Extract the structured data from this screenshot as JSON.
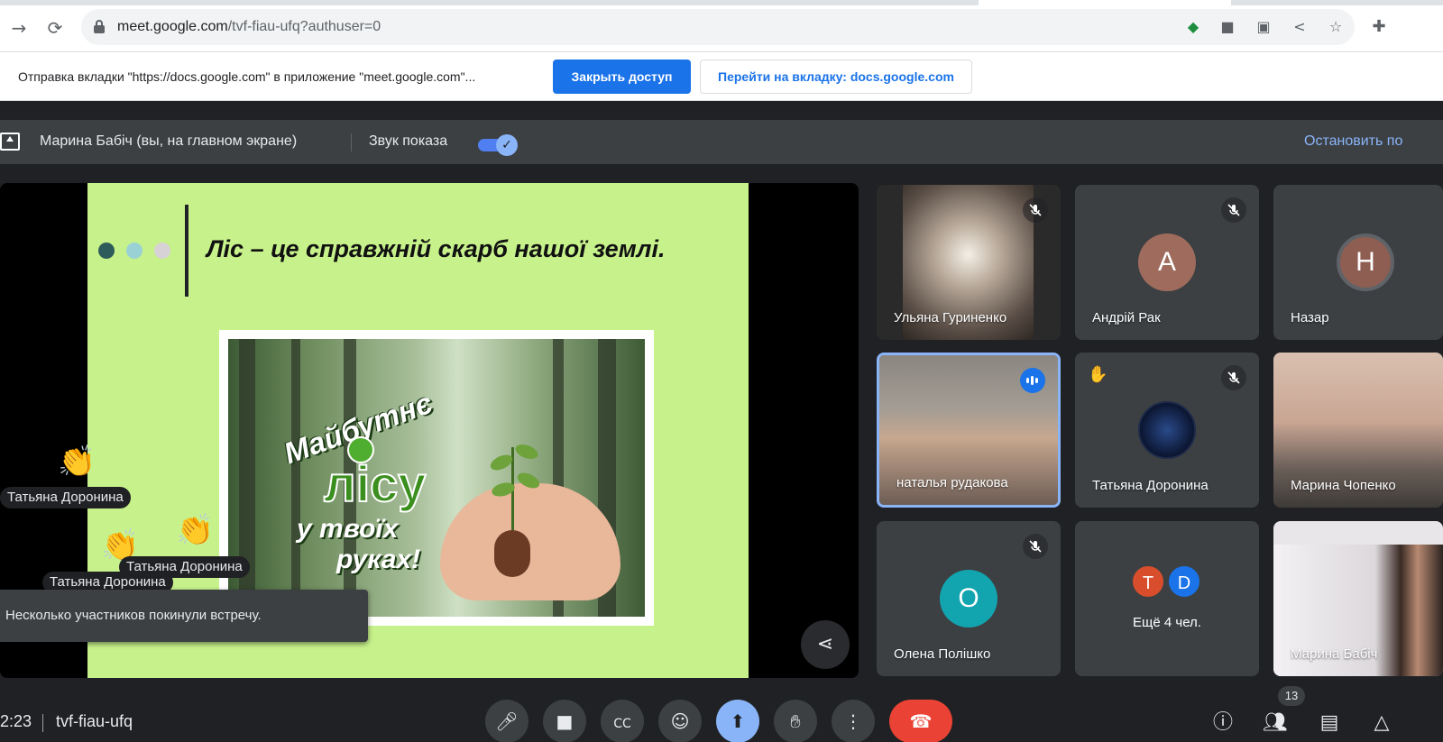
{
  "browser": {
    "url_host": "meet.google.com",
    "url_path": "/tvf-fiau-ufq?authuser=0",
    "icons": [
      "back-icon",
      "reload-icon",
      "lock-icon",
      "meet-extension-icon",
      "camera-icon",
      "translate-icon",
      "share-icon",
      "star-icon",
      "extensions-icon"
    ]
  },
  "infobar": {
    "message": "Отправка вкладки \"https://docs.google.com\" в приложение \"meet.google.com\"...",
    "primary_label": "Закрыть доступ",
    "secondary_label": "Перейти на вкладку: docs.google.com"
  },
  "presenting": {
    "presenter": "Марина Бабіч (вы, на главном экране)",
    "sound_label": "Звук показа",
    "sound_on": true,
    "stop_label": "Остановить по"
  },
  "slide": {
    "title": "Ліс – це справжній скарб нашої землі.",
    "dot_colors": [
      "#2e5c5a",
      "#9ad1d4",
      "#d7d2d6"
    ],
    "poster_line1": "Майбутнє",
    "poster_line2": "лісу",
    "poster_line3": "у твоїх",
    "poster_line4": "руках!"
  },
  "reactions": {
    "emoji": "👏",
    "names": [
      "Татьяна Доронина",
      "Татьяна Доронина",
      "Татьяна Доронина"
    ]
  },
  "toast": "Несколько участников покинули встречу.",
  "participants": [
    {
      "name": "Ульяна Гуриненко",
      "muted": true
    },
    {
      "name": "Андрій Рак",
      "initial": "А",
      "color": "#9e6b5c",
      "muted": true
    },
    {
      "name": "Назар",
      "initial": "Н",
      "color": "#8d5e51"
    },
    {
      "name": "наталья рудакова",
      "speaking": true
    },
    {
      "name": "Татьяна Доронина",
      "muted": true,
      "hand_raised": true
    },
    {
      "name": "Марина Чопенко"
    },
    {
      "name": "Олена Полішко",
      "initial": "О",
      "color": "#12a4af",
      "muted": true
    },
    {
      "name": "Ещё 4 чел.",
      "initials": [
        "Т",
        "D"
      ],
      "colors": [
        "#d84e2c",
        "#1a73e8"
      ]
    },
    {
      "name": "Марина Бабіч"
    }
  ],
  "footer": {
    "time": "2:23",
    "meeting_code": "tvf-fiau-ufq",
    "people_count": "13"
  }
}
